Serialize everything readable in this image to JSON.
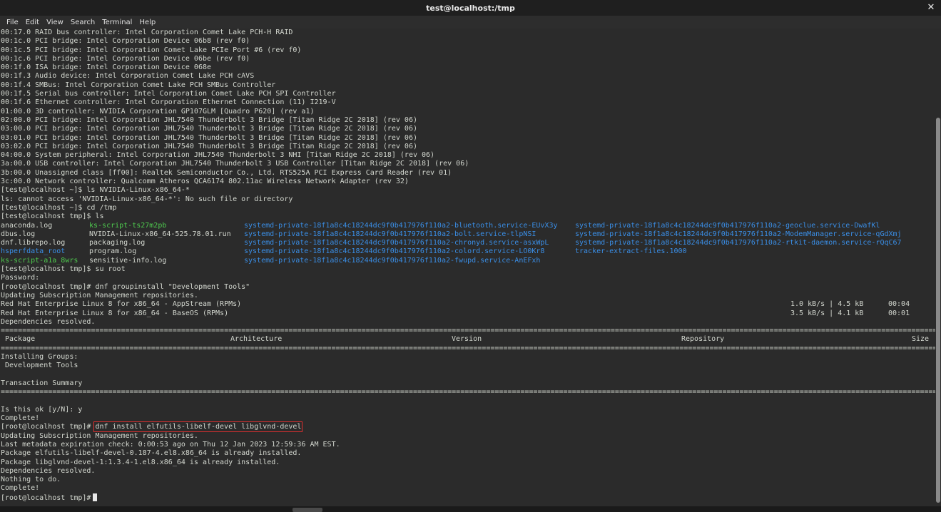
{
  "window": {
    "title": "test@localhost:/tmp",
    "close_glyph": "✕"
  },
  "menu": [
    "File",
    "Edit",
    "View",
    "Search",
    "Terminal",
    "Help"
  ],
  "lines_top": [
    "00:17.0 RAID bus controller: Intel Corporation Comet Lake PCH-H RAID",
    "00:1c.0 PCI bridge: Intel Corporation Device 06b8 (rev f0)",
    "00:1c.5 PCI bridge: Intel Corporation Comet Lake PCIe Port #6 (rev f0)",
    "00:1c.6 PCI bridge: Intel Corporation Device 06be (rev f0)",
    "00:1f.0 ISA bridge: Intel Corporation Device 068e",
    "00:1f.3 Audio device: Intel Corporation Comet Lake PCH cAVS",
    "00:1f.4 SMBus: Intel Corporation Comet Lake PCH SMBus Controller",
    "00:1f.5 Serial bus controller: Intel Corporation Comet Lake PCH SPI Controller",
    "00:1f.6 Ethernet controller: Intel Corporation Ethernet Connection (11) I219-V",
    "01:00.0 3D controller: NVIDIA Corporation GP107GLM [Quadro P620] (rev a1)",
    "02:00.0 PCI bridge: Intel Corporation JHL7540 Thunderbolt 3 Bridge [Titan Ridge 2C 2018] (rev 06)",
    "03:00.0 PCI bridge: Intel Corporation JHL7540 Thunderbolt 3 Bridge [Titan Ridge 2C 2018] (rev 06)",
    "03:01.0 PCI bridge: Intel Corporation JHL7540 Thunderbolt 3 Bridge [Titan Ridge 2C 2018] (rev 06)",
    "03:02.0 PCI bridge: Intel Corporation JHL7540 Thunderbolt 3 Bridge [Titan Ridge 2C 2018] (rev 06)",
    "04:00.0 System peripheral: Intel Corporation JHL7540 Thunderbolt 3 NHI [Titan Ridge 2C 2018] (rev 06)",
    "3a:00.0 USB controller: Intel Corporation JHL7540 Thunderbolt 3 USB Controller [Titan Ridge 2C 2018] (rev 06)",
    "3b:00.0 Unassigned class [ff00]: Realtek Semiconductor Co., Ltd. RTS525A PCI Express Card Reader (rev 01)",
    "3c:00.0 Network controller: Qualcomm Atheros QCA6174 802.11ac Wireless Network Adapter (rev 32)",
    "[test@localhost ~]$ ls NVIDIA-Linux-x86_64-*",
    "ls: cannot access 'NVIDIA-Linux-x86_64-*': No such file or directory",
    "[test@localhost ~]$ cd /tmp",
    "[test@localhost tmp]$ ls"
  ],
  "ls_rows": [
    [
      {
        "t": "anaconda.log",
        "c": ""
      },
      {
        "t": "ks-script-ts27m2pb",
        "c": "green"
      },
      {
        "t": "systemd-private-18f1a8c4c18244dc9f0b417976f110a2-bluetooth.service-EUvX3y",
        "c": "blue"
      },
      {
        "t": "systemd-private-18f1a8c4c18244dc9f0b417976f110a2-geoclue.service-DwafKl",
        "c": "blue"
      }
    ],
    [
      {
        "t": "dbus.log",
        "c": ""
      },
      {
        "t": "NVIDIA-Linux-x86_64-525.78.01.run",
        "c": ""
      },
      {
        "t": "systemd-private-18f1a8c4c18244dc9f0b417976f110a2-bolt.service-tlpNSI",
        "c": "blue"
      },
      {
        "t": "systemd-private-18f1a8c4c18244dc9f0b417976f110a2-ModemManager.service-qGdXmj",
        "c": "blue"
      }
    ],
    [
      {
        "t": "dnf.librepo.log",
        "c": ""
      },
      {
        "t": "packaging.log",
        "c": ""
      },
      {
        "t": "systemd-private-18f1a8c4c18244dc9f0b417976f110a2-chronyd.service-asxWpL",
        "c": "blue"
      },
      {
        "t": "systemd-private-18f1a8c4c18244dc9f0b417976f110a2-rtkit-daemon.service-rQqC67",
        "c": "blue"
      }
    ],
    [
      {
        "t": "hsperfdata_root",
        "c": "blue"
      },
      {
        "t": "program.log",
        "c": ""
      },
      {
        "t": "systemd-private-18f1a8c4c18244dc9f0b417976f110a2-colord.service-LO0Kr8",
        "c": "blue"
      },
      {
        "t": "tracker-extract-files.1000",
        "c": "blue"
      }
    ],
    [
      {
        "t": "ks-script-a1a_8wrs",
        "c": "green"
      },
      {
        "t": "sensitive-info.log",
        "c": ""
      },
      {
        "t": "systemd-private-18f1a8c4c18244dc9f0b417976f110a2-fwupd.service-AnEFxh",
        "c": "blue"
      },
      {
        "t": "",
        "c": ""
      }
    ]
  ],
  "lines_mid": [
    "[test@localhost tmp]$ su root",
    "Password:",
    "[root@localhost tmp]# dnf groupinstall \"Development Tools\"",
    "Updating Subscription Management repositories."
  ],
  "repo_rows": [
    {
      "name": "Red Hat Enterprise Linux 8 for x86_64 - AppStream (RPMs)",
      "speed": "1.0 kB/s | 4.5 kB",
      "time": "00:04"
    },
    {
      "name": "Red Hat Enterprise Linux 8 for x86_64 - BaseOS (RPMs)",
      "speed": "3.5 kB/s | 4.1 kB",
      "time": "00:01"
    }
  ],
  "deps_resolved": "Dependencies resolved.",
  "table_header": {
    "package": "Package",
    "arch": "Architecture",
    "version": "Version",
    "repo": "Repository",
    "size": "Size"
  },
  "lines_groups": [
    "Installing Groups:",
    " Development Tools",
    "",
    "Transaction Summary"
  ],
  "lines_confirm": [
    "",
    "Is this ok [y/N]: y",
    "Complete!"
  ],
  "highlight_line": {
    "prompt": "[root@localhost tmp]#",
    "command": "dnf install elfutils-libelf-devel libglvnd-devel"
  },
  "lines_bottom": [
    "Updating Subscription Management repositories.",
    "Last metadata expiration check: 0:00:53 ago on Thu 12 Jan 2023 12:59:36 AM EST.",
    "Package elfutils-libelf-devel-0.187-4.el8.x86_64 is already installed.",
    "Package libglvnd-devel-1:1.3.4-1.el8.x86_64 is already installed.",
    "Dependencies resolved.",
    "Nothing to do.",
    "Complete!"
  ],
  "final_prompt": "[root@localhost tmp]#",
  "separator_char": "="
}
